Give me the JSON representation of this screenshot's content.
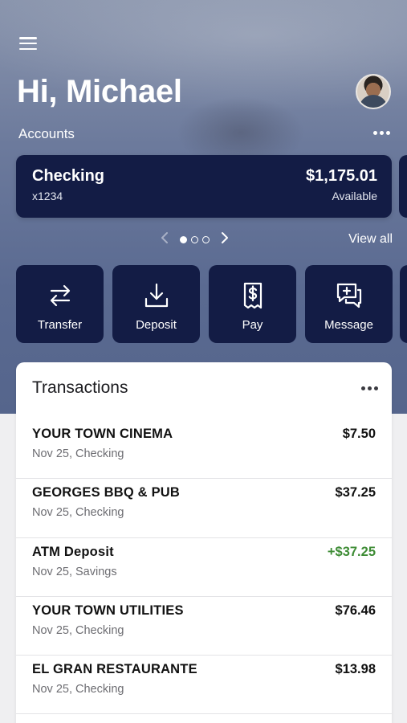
{
  "header": {
    "greeting": "Hi, Michael",
    "menu_icon": "hamburger-menu-icon",
    "avatar": "user-avatar"
  },
  "accounts": {
    "label": "Accounts",
    "card": {
      "name": "Checking",
      "number": "x1234",
      "balance": "$1,175.01",
      "balance_label": "Available"
    },
    "pager": {
      "total": 3,
      "active": 1
    },
    "view_all": "View all"
  },
  "actions": [
    {
      "label": "Transfer",
      "icon": "transfer-icon"
    },
    {
      "label": "Deposit",
      "icon": "deposit-icon"
    },
    {
      "label": "Pay",
      "icon": "pay-bill-icon"
    },
    {
      "label": "Message",
      "icon": "message-icon"
    }
  ],
  "transactions": {
    "title": "Transactions",
    "items": [
      {
        "name": "YOUR TOWN CINEMA",
        "meta": "Nov 25, Checking",
        "amount": "$7.50",
        "type": "debit"
      },
      {
        "name": "GEORGES BBQ & PUB",
        "meta": "Nov 25, Checking",
        "amount": "$37.25",
        "type": "debit"
      },
      {
        "name": "ATM Deposit",
        "meta": "Nov 25, Savings",
        "amount": "+$37.25",
        "type": "credit"
      },
      {
        "name": "YOUR TOWN UTILITIES",
        "meta": "Nov 25, Checking",
        "amount": "$76.46",
        "type": "debit"
      },
      {
        "name": "EL GRAN RESTAURANTE",
        "meta": "Nov 25, Checking",
        "amount": "$13.98",
        "type": "debit"
      }
    ]
  },
  "colors": {
    "card_bg": "#131c45",
    "credit": "#3e8c35"
  }
}
